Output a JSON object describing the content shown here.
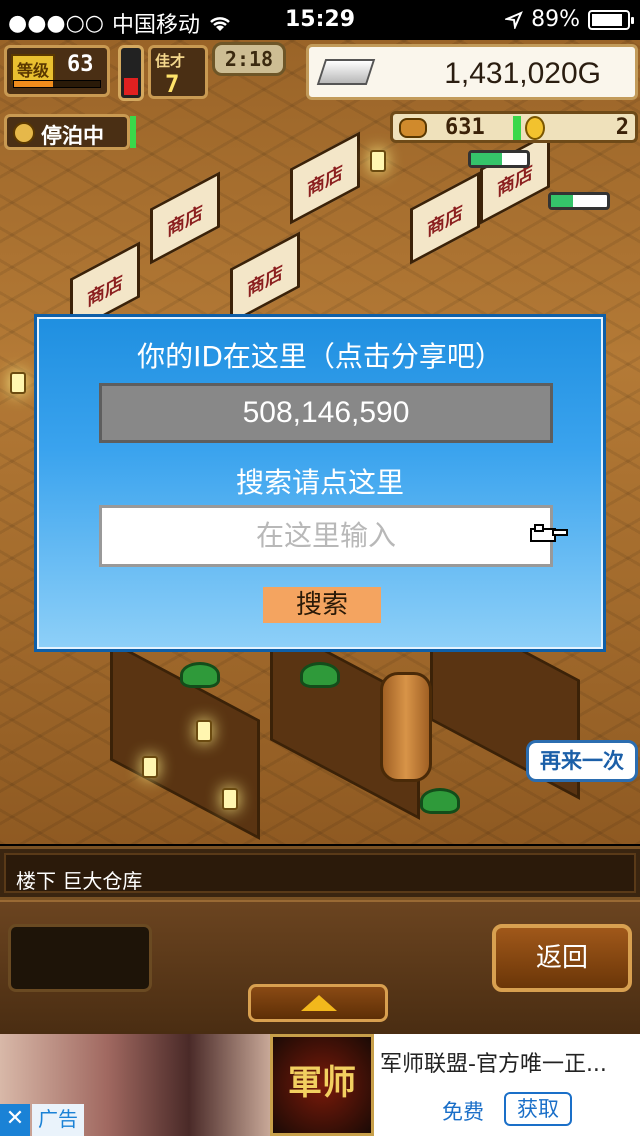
{
  "status_bar": {
    "carrier": "中国移动",
    "time": "15:29",
    "battery_percent": "89%",
    "battery_level": 0.89
  },
  "hud": {
    "level_label": "等级",
    "level": "63",
    "level_progress": 0.45,
    "gauge_level": 0.35,
    "staff_label": "佳才",
    "staff_count": "7",
    "clock": "2:18",
    "gold": "1,431,020G",
    "mooring": "停泊中",
    "resource_count": "631",
    "resource_extra": "2"
  },
  "dialog": {
    "title": "你的ID在这里（点击分享吧）",
    "id_value": "508,146,590",
    "search_title": "搜索请点这里",
    "search_placeholder": "在这里输入",
    "search_button": "搜索"
  },
  "again_button": "再来一次",
  "location": "楼下 巨大仓库",
  "bottom": {
    "back_button": "返回"
  },
  "ad": {
    "close": "✕",
    "label": "广告",
    "app_title": "军师联盟-官方唯一正...",
    "free": "免费",
    "get_button": "获取",
    "logo_text": "軍师"
  },
  "shop_sign": "商店",
  "colors": {
    "dialog_bg": "#3aa3ee",
    "search_button": "#f4a460",
    "gold_panel": "#faf6ec"
  }
}
